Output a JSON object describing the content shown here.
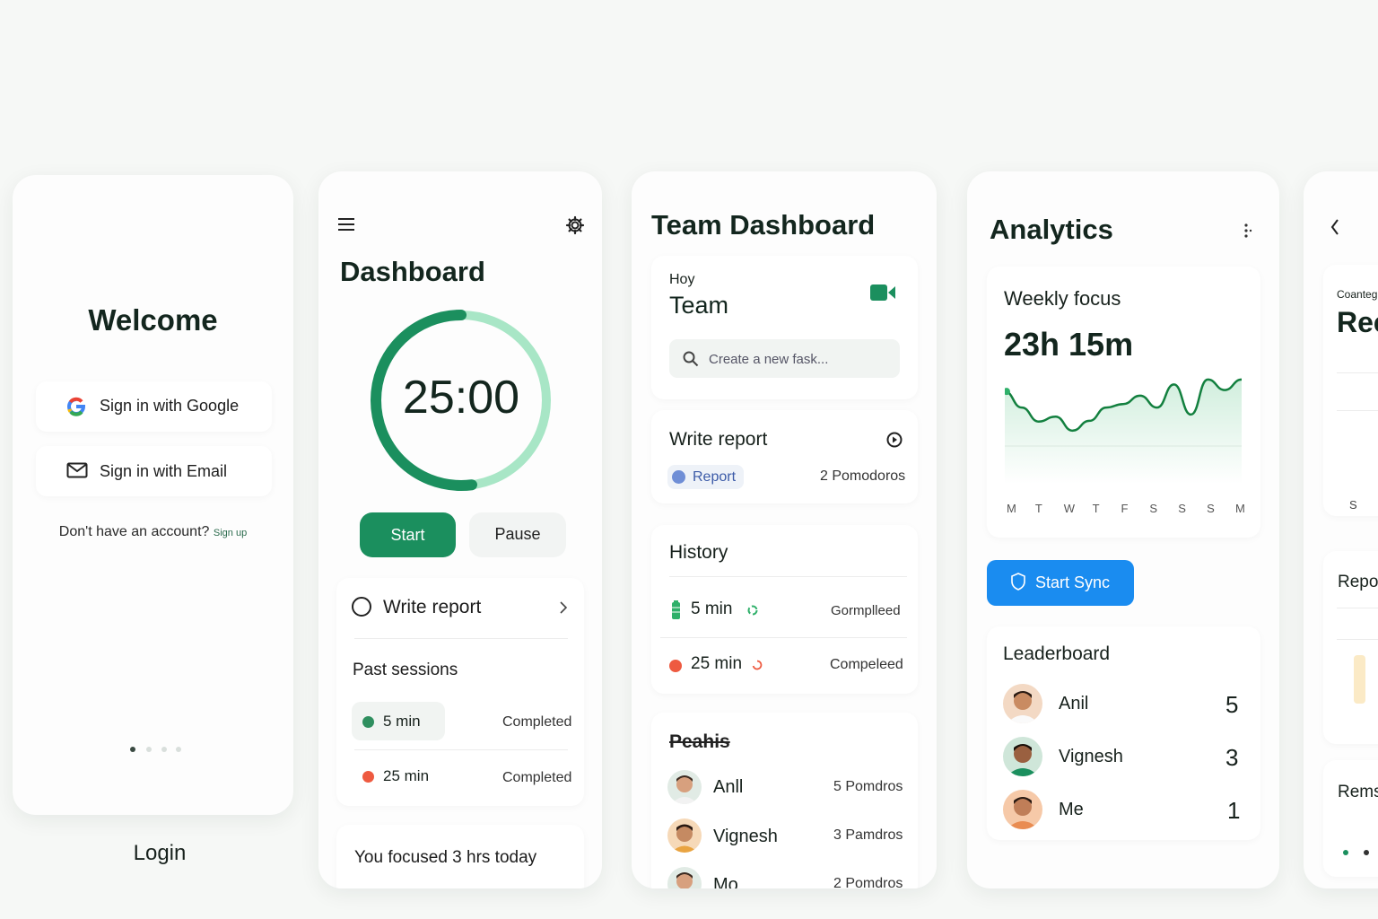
{
  "login": {
    "title": "Welcome",
    "google_button": "Sign in with Google",
    "email_button": "Sign in with Email",
    "no_account": "Don't have an account?",
    "sign_up": "Sign up",
    "caption": "Login"
  },
  "dashboard": {
    "title": "Dashboard",
    "timer": "25:00",
    "timer_progress": 0.52,
    "start": "Start",
    "pause": "Pause",
    "task": "Write report",
    "past_sessions_title": "Past sessions",
    "sessions": [
      {
        "duration": "5 min",
        "status": "Completed",
        "color": "#2f8f5f"
      },
      {
        "duration": "25 min",
        "status": "Completed",
        "color": "#ee5a40"
      }
    ],
    "focused_text": "You focused 3 hrs today"
  },
  "team": {
    "title": "Team Dashboard",
    "greeting": "Hoy",
    "team_label": "Team",
    "search_placeholder": "Create a new fask...",
    "task_title": "Write report",
    "task_tag": "Report",
    "task_pomodoros": "2 Pomodoros",
    "history_title": "History",
    "history": [
      {
        "duration": "5 min",
        "status": "Gormplleed"
      },
      {
        "duration": "25 min",
        "status": "Compeleed"
      }
    ],
    "people_title": "Peahis",
    "people": [
      {
        "name": "Anll",
        "count": "5 Pomdros"
      },
      {
        "name": "Vignesh",
        "count": "3 Pamdros"
      },
      {
        "name": "Mo",
        "count": "2 Pomdros"
      }
    ]
  },
  "analytics": {
    "title": "Analytics",
    "weekly_label": "Weekly focus",
    "weekly_value": "23h 15m",
    "days": [
      "M",
      "T",
      "W",
      "T",
      "F",
      "S",
      "S",
      "S",
      "M"
    ],
    "trend": [
      0.78,
      0.55,
      0.35,
      0.42,
      0.22,
      0.36,
      0.55,
      0.6,
      0.72,
      0.55,
      0.88,
      0.45,
      0.95,
      0.8,
      0.95
    ],
    "sync_button": "Start Sync",
    "leaderboard_title": "Leaderboard",
    "leaders": [
      {
        "name": "Anil",
        "score": "5"
      },
      {
        "name": "Vignesh",
        "score": "3"
      },
      {
        "name": "Me",
        "score": "1"
      }
    ]
  },
  "partial": {
    "small_label": "Coanteg",
    "big_label": "Rec",
    "axis_label": "S",
    "repo_label": "Repo",
    "rems_label": "Rems"
  },
  "colors": {
    "green": "#1b8f5e",
    "green_light": "#a8e6c6",
    "blue": "#1a8cf0",
    "red": "#ee5a40"
  }
}
